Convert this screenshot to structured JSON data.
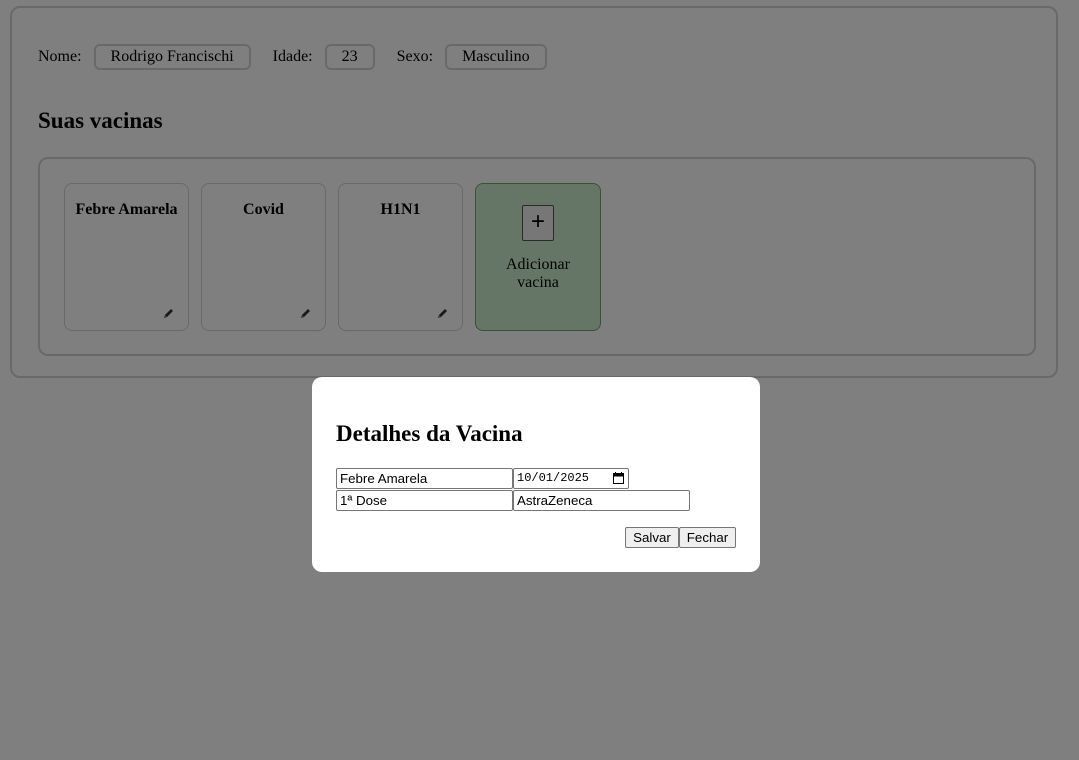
{
  "profile": {
    "name_label": "Nome:",
    "name_value": "Rodrigo Francischi",
    "age_label": "Idade:",
    "age_value": "23",
    "sex_label": "Sexo:",
    "sex_value": "Masculino"
  },
  "vaccines_section": {
    "title": "Suas vacinas",
    "cards": [
      {
        "name": "Febre Amarela",
        "icon": "pencil-icon"
      },
      {
        "name": "Covid",
        "icon": "pencil-icon"
      },
      {
        "name": "H1N1",
        "icon": "pencil-icon"
      }
    ],
    "add_button": {
      "symbol": "+",
      "label": "Adicionar vacina"
    }
  },
  "modal": {
    "title": "Detalhes da Vacina",
    "vaccine_name_value": "Febre Amarela",
    "date_value": "10/01/2025",
    "dose_value": "1ª Dose",
    "manufacturer_value": "AstraZeneca",
    "save_label": "Salvar",
    "close_label": "Fechar"
  },
  "colors": {
    "add_card_bg": "#cdeccd",
    "add_card_border": "#6ea56e",
    "overlay": "rgba(0,0,0,0.5)"
  }
}
